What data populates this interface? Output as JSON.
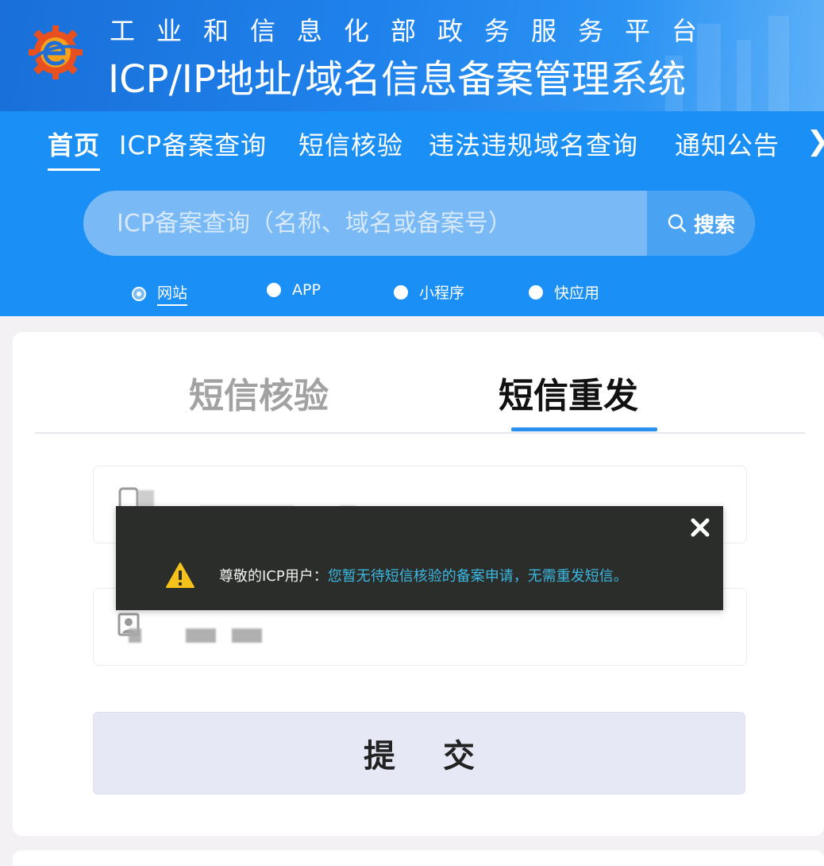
{
  "header": {
    "subtitle": "工业和信息化部政务服务平台",
    "title": "ICP/IP地址/域名信息备案管理系统",
    "brand_color": "#1a6fd8"
  },
  "nav": {
    "items": [
      {
        "label": "首页",
        "active": true
      },
      {
        "label": "ICP备案查询",
        "active": false
      },
      {
        "label": "短信核验",
        "active": false
      },
      {
        "label": "违法违规域名查询",
        "active": false
      },
      {
        "label": "通知公告",
        "active": false
      }
    ],
    "more_glyph": "❯",
    "more_icon": "chevron-right-icon"
  },
  "search": {
    "placeholder": "ICP备案查询（名称、域名或备案号）",
    "value": "",
    "button_label": "搜索",
    "button_icon": "search-icon"
  },
  "types": [
    {
      "label": "网站",
      "checked": true
    },
    {
      "label": "APP",
      "checked": false
    },
    {
      "label": "小程序",
      "checked": false
    },
    {
      "label": "快应用",
      "checked": false
    }
  ],
  "card": {
    "tabs": [
      {
        "label": "短信核验",
        "active": false
      },
      {
        "label": "短信重发",
        "active": true
      }
    ],
    "phone_field": {
      "icon": "phone-icon",
      "value_redacted": true
    },
    "idcard_field": {
      "icon": "id-card-icon",
      "value_redacted": true
    },
    "submit_label": "提交",
    "accent": "#2b8ff0"
  },
  "toast": {
    "prefix": "尊敬的ICP用户：",
    "message": "您暂无待短信核验的备案申请，无需重发短信。",
    "warning_icon": "warning-icon",
    "close_icon": "close-icon",
    "message_color": "#3bb7e0",
    "warning_color": "#f5c21b"
  }
}
